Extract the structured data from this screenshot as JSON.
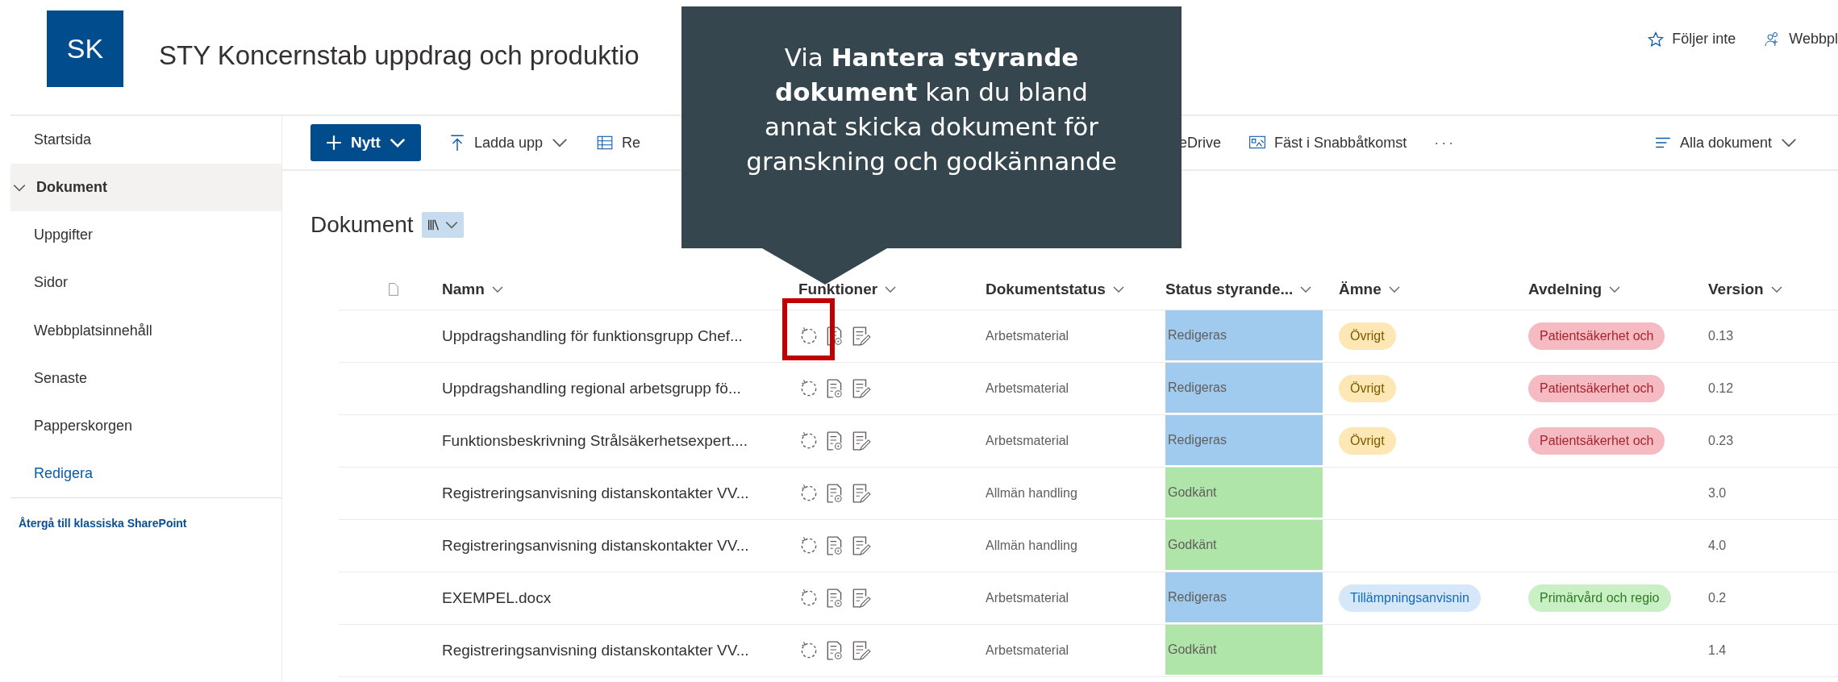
{
  "site": {
    "logo": "SK",
    "title": "STY Koncernstab uppdrag och produktio",
    "actions": [
      {
        "kind": "follow",
        "label": "Följer inte"
      },
      {
        "kind": "share",
        "label": "Webbpl"
      }
    ]
  },
  "nav": {
    "items": [
      {
        "label": "Startsida",
        "kind": "page",
        "selected": false
      },
      {
        "label": "Dokument",
        "kind": "library",
        "selected": true
      },
      {
        "label": "Uppgifter",
        "kind": "page",
        "selected": false
      },
      {
        "label": "Sidor",
        "kind": "page",
        "selected": false
      },
      {
        "label": "Webbplatsinnehåll",
        "kind": "page",
        "selected": false
      },
      {
        "label": "Senaste",
        "kind": "page",
        "selected": false
      },
      {
        "label": "Papperskorgen",
        "kind": "page",
        "selected": false
      },
      {
        "label": "Redigera",
        "kind": "edit",
        "selected": false
      }
    ],
    "footer_link": "Återgå till klassiska SharePoint"
  },
  "toolbar": {
    "left": [
      {
        "kind": "new",
        "label": "Nytt"
      },
      {
        "kind": "upload",
        "label": "Ladda upp"
      },
      {
        "kind": "grid",
        "label": "Re"
      }
    ],
    "right_of_callout": [
      {
        "label": "eDrive"
      },
      {
        "kind": "pin",
        "label": "Fäst i Snabbåtkomst"
      },
      {
        "kind": "more",
        "label": "···"
      }
    ],
    "view": {
      "label": "Alla dokument"
    }
  },
  "library": {
    "title": "Dokument"
  },
  "table": {
    "columns": [
      "Namn",
      "Funktioner",
      "Dokumentstatus",
      "Status styrande...",
      "Ämne",
      "Avdelning",
      "Version"
    ],
    "rows": [
      {
        "name": "Uppdragshandling för funktionsgrupp Chef...",
        "highlighted": true,
        "doc_status": "Arbetsmaterial",
        "governing": {
          "text": "Redigeras",
          "color": "#a0cbef"
        },
        "subject": {
          "text": "Övrigt",
          "color": "#fde7b5"
        },
        "department": {
          "text": "Patientsäkerhet och",
          "color": "#f6bac2"
        },
        "version": "0.13"
      },
      {
        "name": "Uppdragshandling regional arbetsgrupp fö...",
        "highlighted": false,
        "doc_status": "Arbetsmaterial",
        "governing": {
          "text": "Redigeras",
          "color": "#a0cbef"
        },
        "subject": {
          "text": "Övrigt",
          "color": "#fde7b5"
        },
        "department": {
          "text": "Patientsäkerhet och",
          "color": "#f6bac2"
        },
        "version": "0.12"
      },
      {
        "name": "Funktionsbeskrivning Strålsäkerhetsexpert....",
        "highlighted": false,
        "doc_status": "Arbetsmaterial",
        "governing": {
          "text": "Redigeras",
          "color": "#a0cbef"
        },
        "subject": {
          "text": "Övrigt",
          "color": "#fde7b5"
        },
        "department": {
          "text": "Patientsäkerhet och",
          "color": "#f6bac2"
        },
        "version": "0.23"
      },
      {
        "name": "Registreringsanvisning distanskontakter VV...",
        "highlighted": false,
        "doc_status": "Allmän handling",
        "governing": {
          "text": "Godkänt",
          "color": "#afe5a8"
        },
        "version": "3.0"
      },
      {
        "name": "Registreringsanvisning distanskontakter VV...",
        "highlighted": false,
        "doc_status": "Allmän handling",
        "governing": {
          "text": "Godkänt",
          "color": "#afe5a8"
        },
        "version": "4.0"
      },
      {
        "name": "EXEMPEL.docx",
        "highlighted": false,
        "doc_status": "Arbetsmaterial",
        "governing": {
          "text": "Redigeras",
          "color": "#a0cbef"
        },
        "subject": {
          "text": "Tillämpningsanvisnin",
          "color": "#d5e7f8"
        },
        "department": {
          "text": "Primärvård och regio",
          "color": "#c9efc4"
        },
        "version": "0.2"
      },
      {
        "name": "Registreringsanvisning distanskontakter VV...",
        "highlighted": false,
        "doc_status": "Arbetsmaterial",
        "governing": {
          "text": "Godkänt",
          "color": "#afe5a8"
        },
        "version": "1.4"
      }
    ]
  },
  "callout": {
    "text": "Via **Hantera styrande dokument** kan du bland annat skicka dokument för granskning och godkännande"
  }
}
